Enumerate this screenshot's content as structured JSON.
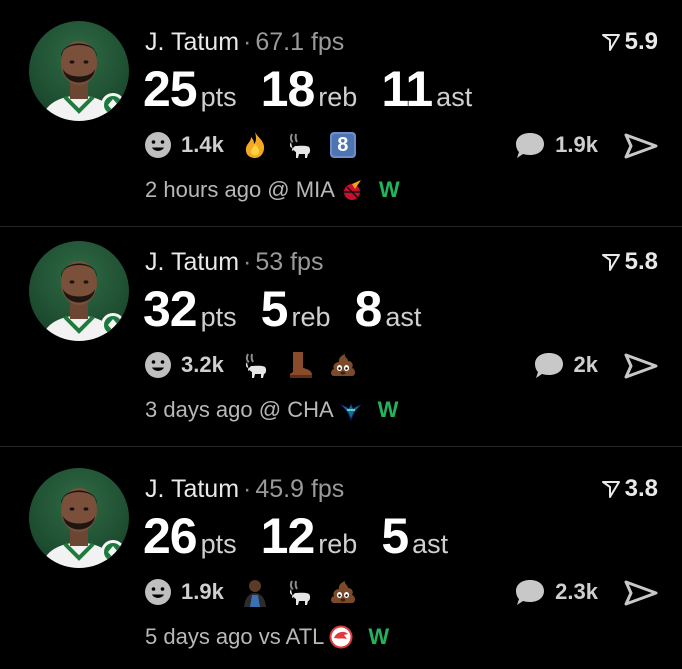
{
  "posts": [
    {
      "player": "J. Tatum",
      "separator": "·",
      "fps": "67.1 fps",
      "rating": "5.9",
      "stats": [
        {
          "value": "25",
          "unit": "pts"
        },
        {
          "value": "18",
          "unit": "reb"
        },
        {
          "value": "11",
          "unit": "ast"
        }
      ],
      "reaction_count": "1.4k",
      "emojis": [
        "fire-emoji",
        "goat-emoji",
        "keycap-8-emoji"
      ],
      "keycap_label": "8",
      "comment_count": "1.9k",
      "time_and_opponent": "2 hours ago @ MIA",
      "opponent_logo": "heat-logo",
      "result": "W"
    },
    {
      "player": "J. Tatum",
      "separator": "·",
      "fps": "53 fps",
      "rating": "5.8",
      "stats": [
        {
          "value": "32",
          "unit": "pts"
        },
        {
          "value": "5",
          "unit": "reb"
        },
        {
          "value": "8",
          "unit": "ast"
        }
      ],
      "reaction_count": "3.2k",
      "emojis": [
        "goat-emoji",
        "boot-emoji",
        "poop-emoji"
      ],
      "comment_count": "2k",
      "time_and_opponent": "3 days ago @ CHA",
      "opponent_logo": "hornets-logo",
      "result": "W"
    },
    {
      "player": "J. Tatum",
      "separator": "·",
      "fps": "45.9 fps",
      "rating": "3.8",
      "stats": [
        {
          "value": "26",
          "unit": "pts"
        },
        {
          "value": "12",
          "unit": "reb"
        },
        {
          "value": "5",
          "unit": "ast"
        }
      ],
      "reaction_count": "1.9k",
      "emojis": [
        "person-emoji",
        "goat-emoji",
        "poop-emoji"
      ],
      "comment_count": "2.3k",
      "time_and_opponent": "5 days ago vs ATL",
      "opponent_logo": "hawks-logo",
      "result": "W"
    }
  ],
  "colors": {
    "background": "#000000",
    "win": "#22b35c",
    "divider": "#262626"
  }
}
